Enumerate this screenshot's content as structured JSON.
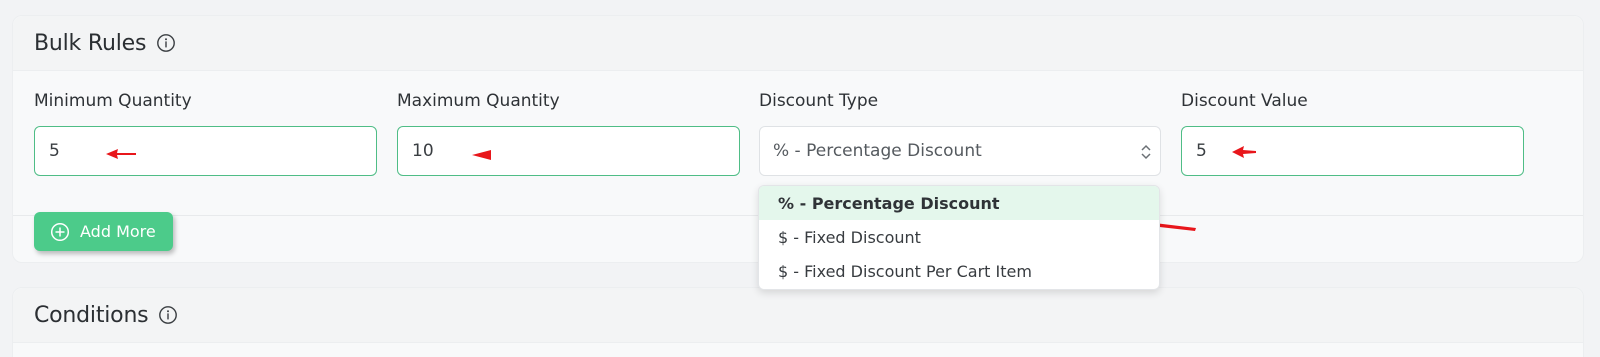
{
  "bulk_rules": {
    "title": "Bulk Rules",
    "info_icon": "info-icon",
    "fields": {
      "min_qty": {
        "label": "Minimum Quantity",
        "value": "5"
      },
      "max_qty": {
        "label": "Maximum Quantity",
        "value": "10"
      },
      "discount_type": {
        "label": "Discount Type",
        "selected": "% - Percentage Discount"
      },
      "discount_value": {
        "label": "Discount Value",
        "value": "5"
      }
    },
    "add_more_label": "Add More",
    "add_more_icon": "plus-circle-icon"
  },
  "dropdown": {
    "options": [
      "% - Percentage Discount",
      "$ - Fixed Discount",
      "$ - Fixed Discount Per Cart Item"
    ],
    "selected_index": 0
  },
  "conditions": {
    "title": "Conditions",
    "info_icon": "info-icon"
  },
  "colors": {
    "accent_green": "#4ccb8a",
    "input_border": "#4fbd86",
    "annotation_red": "#e8161b",
    "selected_option_bg": "#e4f7ec"
  }
}
